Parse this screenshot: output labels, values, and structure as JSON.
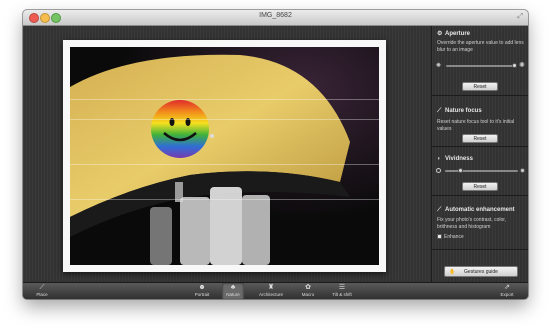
{
  "window": {
    "title": "IMG_8682"
  },
  "sidebar": {
    "aperture": {
      "title": "Aperture",
      "icon": "aperture-icon",
      "description": "Override the aperture value to add lens blur to an image",
      "reset_label": "Reset",
      "slider_value": 0.95
    },
    "nature_focus": {
      "title": "Nature focus",
      "icon": "wand-icon",
      "description": "Reset nature focus tool to it's initial values",
      "reset_label": "Reset"
    },
    "vividness": {
      "title": "Vividness",
      "icon": "drop-icon",
      "reset_label": "Reset",
      "slider_value": 0.25
    },
    "auto_enhance": {
      "title": "Automatic enhancement",
      "icon": "wand-icon",
      "description": "Fix your photo's contrast, color, brithness and histogram",
      "checkbox_label": "Enhance",
      "checked": false
    },
    "gestures_label": "Gestures guide"
  },
  "toolbar": {
    "place": "Place",
    "portrait": "Portrait",
    "nature": "Nature",
    "architecture": "Architecture",
    "macro": "Macro",
    "tilt_shift": "Tilt & shift",
    "export": "Export",
    "active_tool": "nature"
  },
  "colors": {
    "accent_yellow": "#e8c85a",
    "window_bg": "#2b2b2b"
  }
}
